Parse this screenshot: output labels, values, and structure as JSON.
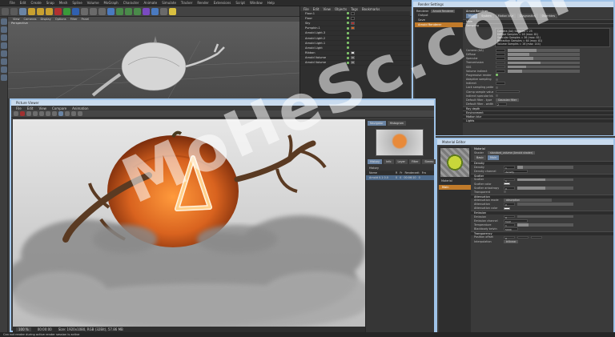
{
  "menubar": [
    "File",
    "Edit",
    "Create",
    "Snap",
    "Mesh",
    "Spline",
    "Volume",
    "MoGraph",
    "Character",
    "Animate",
    "Simulate",
    "Tracker",
    "Render",
    "Extensions",
    "Script",
    "Window",
    "Help"
  ],
  "viewport": {
    "menu": [
      "View",
      "Cameras",
      "Display",
      "Options",
      "Filter",
      "Panel"
    ],
    "label": "Perspective"
  },
  "objects": {
    "header": [
      "File",
      "Edit",
      "View",
      "Objects",
      "Tags",
      "Bookmarks"
    ],
    "rows": [
      "Floor.1",
      "Floor",
      "Sky",
      "Pumpkin.1",
      "Arnold Light.3",
      "Arnold Light.2",
      "Arnold Light.1",
      "Arnold Light",
      "Ribbon",
      "Arnold Volume",
      "Arnold Volume"
    ]
  },
  "render_view": {
    "title": "Picture Viewer",
    "menu": [
      "File",
      "Edit",
      "View",
      "Compare",
      "Animation"
    ],
    "status_left": "100 %",
    "status_time": "00:00:00",
    "status_info": "Size: 1920x1080, RGB (32Bit), 57.86 MB",
    "sidebar_tabs_top": [
      "Navigator",
      "Histogram"
    ],
    "sidebar_tabs": [
      "History",
      "Info",
      "Layer",
      "Filter",
      "Stereo"
    ],
    "history_label": "History",
    "history_cols": [
      "Name",
      "R",
      "Fr",
      "Renderzeit",
      "Fra"
    ],
    "history_row": [
      "Arnold 0.1 0.0",
      "0",
      "0",
      "00:06:10",
      "0"
    ]
  },
  "render_settings": {
    "title": "Render Settings",
    "renderer_label": "Renderer",
    "renderer_value": "Arnold Renderer",
    "left_items": [
      "Output",
      "Save",
      "Arnold Renderer"
    ],
    "main_title": "Arnold Renderer",
    "tabs": [
      "Main",
      "System",
      "Motion blur",
      "Diagnostics",
      "Overrides"
    ],
    "section_main": "Main",
    "section_sampling": "Sampling",
    "samples_list": [
      "Camera (AA) Samples = 25",
      "Diffuse Samples = 16 (max: 81)",
      "Specular Samples = 36 (max: 81)",
      "Refraction Samples = 64 (max: 81)",
      "Volume Samples = 16 (max: 144)"
    ],
    "params": [
      "Camera (AA)",
      "Diffuse",
      "Specular",
      "Transmission",
      "SSS",
      "Volume indirect",
      "Progressive render",
      "Adaptive sampling",
      "Indirect",
      "Lock sampling pattern",
      "Clamp sample values",
      "Indirect specular blur",
      "Default filter - type",
      "Default filter - width"
    ],
    "filter_type": "Gaussian filter",
    "filter_width": "2",
    "sections_bottom": [
      "Ray depth",
      "Environment",
      "Motion blur",
      "Lights"
    ],
    "progress_note": "Progressive rendering"
  },
  "material_editor": {
    "title": "Material Editor",
    "material_name": "Material",
    "shader_label": "Shader",
    "shader_value": "standard_volume (Arnold shader)",
    "tabs": [
      "Basic",
      "Main"
    ],
    "node_label": "Main",
    "left_name": "Material",
    "sections": [
      "Density",
      "Scatter",
      "Emission",
      "Attenuation",
      "Transparency"
    ],
    "params": [
      {
        "label": "Density",
        "value": "1"
      },
      {
        "label": "Density channel",
        "value": "density"
      },
      {
        "label": "Scatter",
        "value": "1"
      },
      {
        "label": "Scatter color",
        "value": ""
      },
      {
        "label": "Scatter anisotropy",
        "value": "0"
      },
      {
        "label": "Transparent",
        "value": "0"
      },
      {
        "label": "Attenuation mode",
        "value": "absorption"
      },
      {
        "label": "Attenuation",
        "value": "0"
      },
      {
        "label": "Attenuation color",
        "value": ""
      },
      {
        "label": "Emission",
        "value": "0"
      },
      {
        "label": "Emission channel",
        "value": "heat"
      },
      {
        "label": "Temperature",
        "value": "1"
      },
      {
        "label": "Blackbody kelvin",
        "value": "5000"
      },
      {
        "label": "Position offset",
        "value": "0"
      },
      {
        "label": "Interpolation",
        "value": "trilinear"
      }
    ]
  },
  "status_bar": "Can not render during active render session is active",
  "watermark": "MoHeSc.com",
  "colors": {
    "accent": "#9fc3e8",
    "selected": "#c07a2a",
    "pumpkin": "#d9631f",
    "check": "#7ec26a"
  }
}
